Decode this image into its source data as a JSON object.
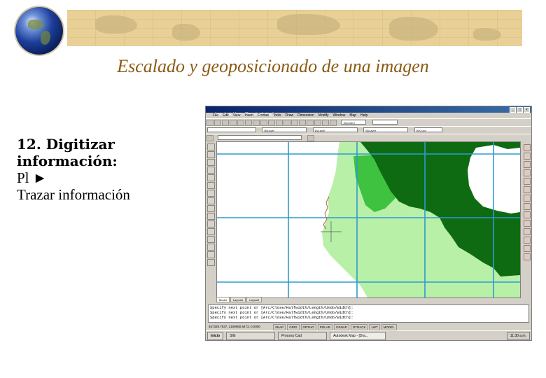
{
  "slide": {
    "title": "Escalado y  geoposicionado de una imagen",
    "left_text": {
      "line1": "12. Digitizar",
      "line2": "información:",
      "line3": "Pl ►",
      "line4": "Trazar información"
    }
  },
  "app": {
    "window_title": "Autodesk Map - [Drawing1.dwg]",
    "menus": [
      "File",
      "Edit",
      "View",
      "Insert",
      "Format",
      "Tools",
      "Draw",
      "Dimension",
      "Modify",
      "Window",
      "Map",
      "Help"
    ],
    "style_combo": "Standard",
    "layer_combo": "ByLayer",
    "color_combo": "ByColor",
    "tabs": [
      "Model",
      "Layout1",
      "Layout2"
    ],
    "command_lines": [
      "Specify next point or [Arc/Close/Halfwidth/Length/Undo/Width]:",
      "Specify next point or [Arc/Close/Halfwidth/Length/Undo/Width]:",
      "Specify next point or [Arc/Close/Halfwidth/Length/Undo/Width]:"
    ],
    "coordinates": "467328.7837, 2108960.5473, 0.0000",
    "status_buttons": [
      "SNAP",
      "GRID",
      "ORTHO",
      "POLAR",
      "OSNAP",
      "OTRACK",
      "LWT",
      "MODEL"
    ],
    "taskbar": {
      "start": "Inicio",
      "tasks": [
        "SIG",
        "Proceso Cad",
        "Autodesk Map - [Dra..."
      ],
      "clock": "11:30 a.m."
    },
    "colors": {
      "dark_green": "#0e6b12",
      "mid_green": "#3fc23f",
      "light_green": "#b8f0a8",
      "grid_blue": "#2e9ad0",
      "title_brown": "#8b5a14"
    }
  }
}
